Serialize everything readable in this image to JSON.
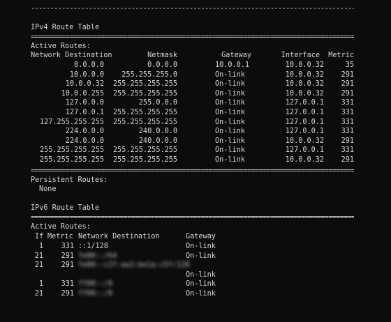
{
  "rules": {
    "dash": "------------------------------------------------------------------------------------------------",
    "equals": "================================================================================================"
  },
  "ipv4": {
    "title": "IPv4 Route Table",
    "active_label": "Active Routes:",
    "headers": [
      "Network Destination",
      "Netmask",
      "Gateway",
      "Interface",
      "Metric"
    ],
    "routes": [
      [
        "0.0.0.0",
        "0.0.0.0",
        "10.0.0.1",
        "10.0.0.32",
        "35"
      ],
      [
        "10.0.0.0",
        "255.255.255.0",
        "On-link",
        "10.0.0.32",
        "291"
      ],
      [
        "10.0.0.32",
        "255.255.255.255",
        "On-link",
        "10.0.0.32",
        "291"
      ],
      [
        "10.0.0.255",
        "255.255.255.255",
        "On-link",
        "10.0.0.32",
        "291"
      ],
      [
        "127.0.0.0",
        "255.0.0.0",
        "On-link",
        "127.0.0.1",
        "331"
      ],
      [
        "127.0.0.1",
        "255.255.255.255",
        "On-link",
        "127.0.0.1",
        "331"
      ],
      [
        "127.255.255.255",
        "255.255.255.255",
        "On-link",
        "127.0.0.1",
        "331"
      ],
      [
        "224.0.0.0",
        "240.0.0.0",
        "On-link",
        "127.0.0.1",
        "331"
      ],
      [
        "224.0.0.0",
        "240.0.0.0",
        "On-link",
        "10.0.0.32",
        "291"
      ],
      [
        "255.255.255.255",
        "255.255.255.255",
        "On-link",
        "127.0.0.1",
        "331"
      ],
      [
        "255.255.255.255",
        "255.255.255.255",
        "On-link",
        "10.0.0.32",
        "291"
      ]
    ],
    "persistent_label": "Persistent Routes:",
    "persistent_value": "None"
  },
  "ipv6": {
    "title": "IPv6 Route Table",
    "active_label": "Active Routes:",
    "headers": [
      "If",
      "Metric",
      "Network Destination",
      "Gateway"
    ],
    "routes": [
      {
        "if": "1",
        "metric": "331",
        "dest": "::1/128",
        "gateway": "On-link",
        "redacted": false
      },
      {
        "if": "21",
        "metric": "291",
        "dest": "fe80::/64",
        "gateway": "On-link",
        "redacted": true
      },
      {
        "if": "21",
        "metric": "291",
        "dest": "fe80::c2f:aa3:be1a:c5f/128",
        "gateway": "",
        "redacted": true
      },
      {
        "if": "",
        "metric": "",
        "dest": "",
        "gateway": "On-link",
        "redacted": false
      },
      {
        "if": "1",
        "metric": "331",
        "dest": "ff00::/8",
        "gateway": "On-link",
        "redacted": true
      },
      {
        "if": "21",
        "metric": "291",
        "dest": "ff00::/8",
        "gateway": "On-link",
        "redacted": true
      }
    ]
  }
}
